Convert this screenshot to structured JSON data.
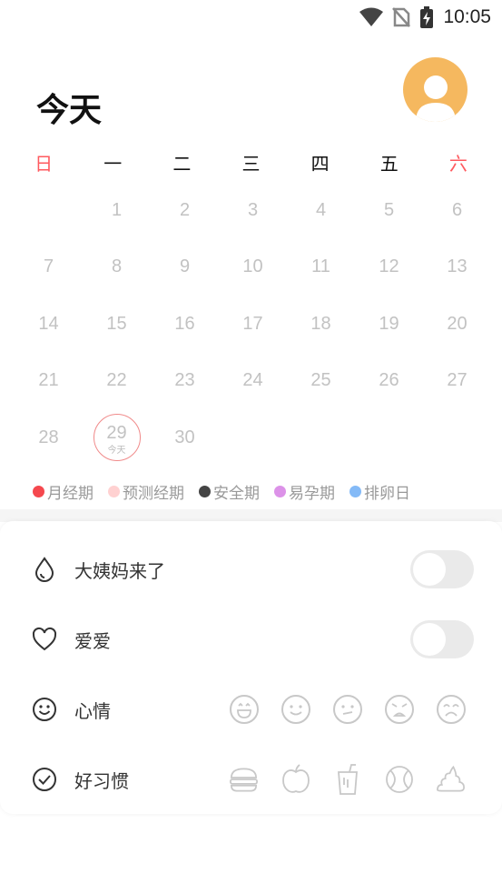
{
  "status_bar": {
    "time": "10:05"
  },
  "header": {
    "title": "今天"
  },
  "calendar": {
    "weekdays": [
      "日",
      "一",
      "二",
      "三",
      "四",
      "五",
      "六"
    ],
    "rows": [
      [
        "",
        "1",
        "2",
        "3",
        "4",
        "5",
        "6"
      ],
      [
        "7",
        "8",
        "9",
        "10",
        "11",
        "12",
        "13"
      ],
      [
        "14",
        "15",
        "16",
        "17",
        "18",
        "19",
        "20"
      ],
      [
        "21",
        "22",
        "23",
        "24",
        "25",
        "26",
        "27"
      ],
      [
        "28",
        "29",
        "30",
        "",
        "",
        "",
        ""
      ]
    ],
    "today": {
      "day": "29",
      "label": "今天"
    }
  },
  "legend": [
    {
      "label": "月经期",
      "color": "#f5484e"
    },
    {
      "label": "预测经期",
      "color": "#ffd1d1"
    },
    {
      "label": "安全期",
      "color": "#444444"
    },
    {
      "label": "易孕期",
      "color": "#dc92e8"
    },
    {
      "label": "排卵日",
      "color": "#84baf7"
    }
  ],
  "records": {
    "period": {
      "label": "大姨妈来了",
      "icon": "drop-icon",
      "on": false
    },
    "love": {
      "label": "爱爱",
      "icon": "heart-icon",
      "on": false
    },
    "mood": {
      "label": "心情",
      "icon": "smiley-icon",
      "options": [
        "laugh-face-icon",
        "smile-face-icon",
        "neutral-face-icon",
        "angry-face-icon",
        "cry-face-icon"
      ]
    },
    "habits": {
      "label": "好习惯",
      "icon": "check-circle-icon",
      "options": [
        "food-icon",
        "apple-icon",
        "drink-icon",
        "ball-icon",
        "poop-icon"
      ]
    }
  },
  "colors": {
    "accent_red": "#ff5a5f",
    "avatar_bg": "#f5b85f"
  }
}
